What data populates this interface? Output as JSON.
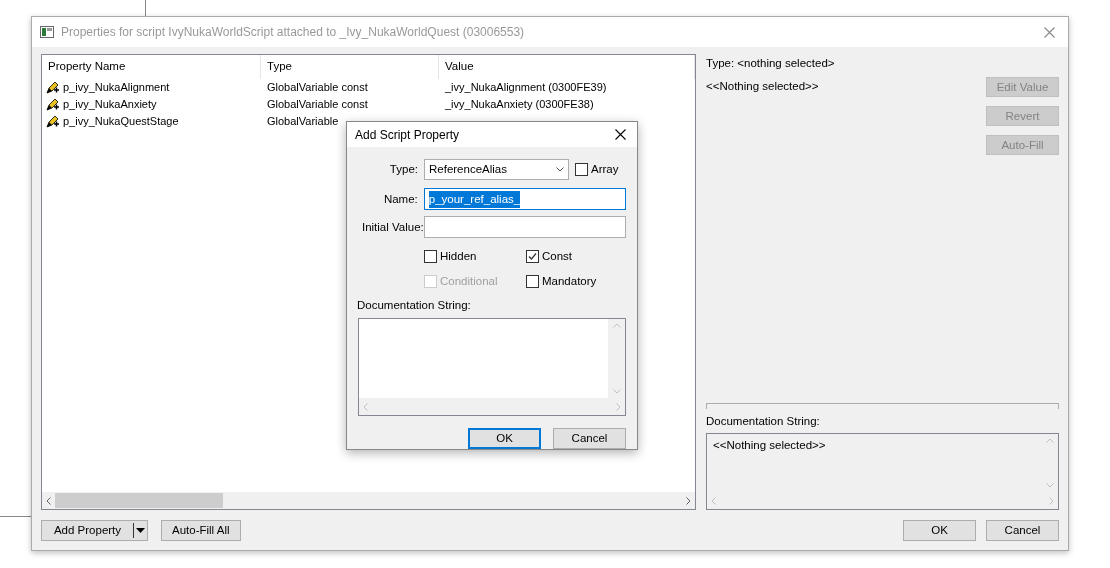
{
  "window": {
    "title": "Properties for script IvyNukaWorldScript attached to _Ivy_NukaWorldQuest (03006553)"
  },
  "table": {
    "columns": [
      "Property Name",
      "Type",
      "Value"
    ],
    "rows": [
      {
        "cells": [
          "p_ivy_NukaAlignment",
          "GlobalVariable const",
          "_ivy_NukaAlignment (0300FE39)"
        ]
      },
      {
        "cells": [
          "p_ivy_NukaAnxiety",
          "GlobalVariable const",
          "_ivy_NukaAnxiety (0300FE38)"
        ]
      },
      {
        "cells": [
          "p_ivy_NukaQuestStage",
          "GlobalVariable"
        ]
      }
    ]
  },
  "table_buttons": [
    {
      "label": "Add Property",
      "kind": "split"
    },
    {
      "label": "Auto-Fill All",
      "kind": "plain"
    }
  ],
  "details": {
    "type_label": "Type: <nothing selected>",
    "value_text": "<<Nothing selected>>",
    "buttons": [
      {
        "label": "Edit Value",
        "disabled": true
      },
      {
        "label": "Revert",
        "disabled": true
      },
      {
        "label": "Auto-Fill",
        "disabled": true
      }
    ],
    "documentation_label": "Documentation String:",
    "documentation_text": "<<Nothing selected>>"
  },
  "footer_buttons": [
    {
      "label": "OK"
    },
    {
      "label": "Cancel"
    }
  ],
  "dialog": {
    "title": "Add Script Property",
    "type": {
      "label": "Type:",
      "value": "ReferenceAlias"
    },
    "array": {
      "label": "Array",
      "checked": false,
      "disabled": false
    },
    "name": {
      "label": "Name:",
      "value": "p_your_ref_alias_",
      "selected": true
    },
    "initial_value": {
      "label": "Initial Value:"
    },
    "options": [
      {
        "label": "Hidden",
        "checked": false,
        "disabled": false
      },
      {
        "label": "Const",
        "checked": true,
        "disabled": false
      },
      {
        "label": "Conditional",
        "checked": false,
        "disabled": true
      },
      {
        "label": "Mandatory",
        "checked": false,
        "disabled": false
      }
    ],
    "documentation_label": "Documentation String:",
    "buttons": [
      {
        "label": "OK",
        "default": true
      },
      {
        "label": "Cancel",
        "default": false
      }
    ]
  }
}
